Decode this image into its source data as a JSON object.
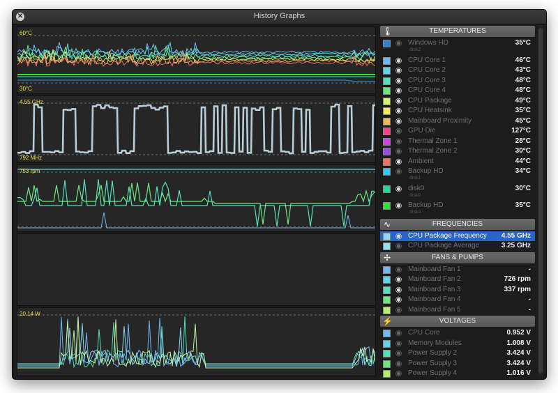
{
  "window": {
    "title": "History Graphs"
  },
  "graphs": {
    "panel1": {
      "top_label": "60°C",
      "bottom_label": "30°C"
    },
    "panel2": {
      "top_label": "4.55 GHz",
      "bottom_label": "792 MHz"
    },
    "panel3": {
      "top_label": "753 rpm"
    },
    "panel4": {},
    "panel5": {
      "top_label": "20.14 W"
    }
  },
  "sidebar": {
    "sections": [
      {
        "header": "TEMPERATURES",
        "icon": "thermometer-icon",
        "rows": [
          {
            "name": "Windows HD",
            "sub": "disk2",
            "value": "35°C",
            "color": "#2f7fd2",
            "eye": false
          },
          {
            "name": "CPU Core 1",
            "value": "46°C",
            "color": "#6fb8f5",
            "eye": true
          },
          {
            "name": "CPU Core 2",
            "value": "43°C",
            "color": "#5fd4ec",
            "eye": true
          },
          {
            "name": "CPU Core 3",
            "value": "48°C",
            "color": "#55e0bb",
            "eye": true
          },
          {
            "name": "CPU Core 4",
            "value": "48°C",
            "color": "#6ee87e",
            "eye": true
          },
          {
            "name": "CPU Package",
            "value": "49°C",
            "color": "#d6f26c",
            "eye": true
          },
          {
            "name": "CPU Heatsink",
            "value": "35°C",
            "color": "#f0ec5c",
            "eye": true
          },
          {
            "name": "Mainboard Proximity",
            "value": "45°C",
            "color": "#f4b85c",
            "eye": true
          },
          {
            "name": "GPU Die",
            "value": "127°C",
            "color": "#f2428a",
            "eye": false
          },
          {
            "name": "Thermal Zone 1",
            "value": "28°C",
            "color": "#d242e2",
            "eye": false
          },
          {
            "name": "Thermal Zone 2",
            "value": "30°C",
            "color": "#9a4ae2",
            "eye": false
          },
          {
            "name": "Ambient",
            "value": "44°C",
            "color": "#f07262",
            "eye": true
          },
          {
            "name": "Backup HD",
            "sub": "disk1",
            "value": "34°C",
            "color": "#35c8f2",
            "eye": false
          },
          {
            "name": "disk0",
            "sub": "disk0",
            "value": "30°C",
            "color": "#25d895",
            "eye": true
          },
          {
            "name": "Backup HD",
            "sub": "disk4",
            "value": "35°C",
            "color": "#34e034",
            "eye": true
          }
        ]
      },
      {
        "header": "FREQUENCIES",
        "icon": "frequency-icon",
        "rows": [
          {
            "name": "CPU Package Frequency",
            "value": "4.55 GHz",
            "color": "#8fd8f5",
            "eye": true,
            "selected": true
          },
          {
            "name": "CPU Package Average",
            "value": "3.25 GHz",
            "color": "#8fe3f2",
            "eye": false
          }
        ]
      },
      {
        "header": "FANS & PUMPS",
        "icon": "fan-icon",
        "rows": [
          {
            "name": "Mainboard Fan 1",
            "value": "-",
            "color": "#6fb8f5",
            "eye": false
          },
          {
            "name": "Mainboard Fan 2",
            "value": "726 rpm",
            "color": "#5fd4ec",
            "eye": true
          },
          {
            "name": "Mainboard Fan 3",
            "value": "337 rpm",
            "color": "#55e0bb",
            "eye": true
          },
          {
            "name": "Mainboard Fan 4",
            "value": "-",
            "color": "#6ee87e",
            "eye": true
          },
          {
            "name": "Mainboard Fan 5",
            "value": "-",
            "color": "#b6ec6c",
            "eye": false
          }
        ]
      },
      {
        "header": "VOLTAGES",
        "icon": "lightning-icon",
        "rows": [
          {
            "name": "CPU Core",
            "value": "0.952 V",
            "color": "#6fb8f5",
            "eye": false
          },
          {
            "name": "Memory Modules",
            "value": "1.008 V",
            "color": "#5fd4ec",
            "eye": false
          },
          {
            "name": "Power Supply 2",
            "value": "3.424 V",
            "color": "#55e0bb",
            "eye": false
          },
          {
            "name": "Power Supply 3",
            "value": "3.424 V",
            "color": "#6ee87e",
            "eye": false
          },
          {
            "name": "Power Supply 4",
            "value": "1.016 V",
            "color": "#b6ec6c",
            "eye": false
          }
        ]
      }
    ]
  }
}
